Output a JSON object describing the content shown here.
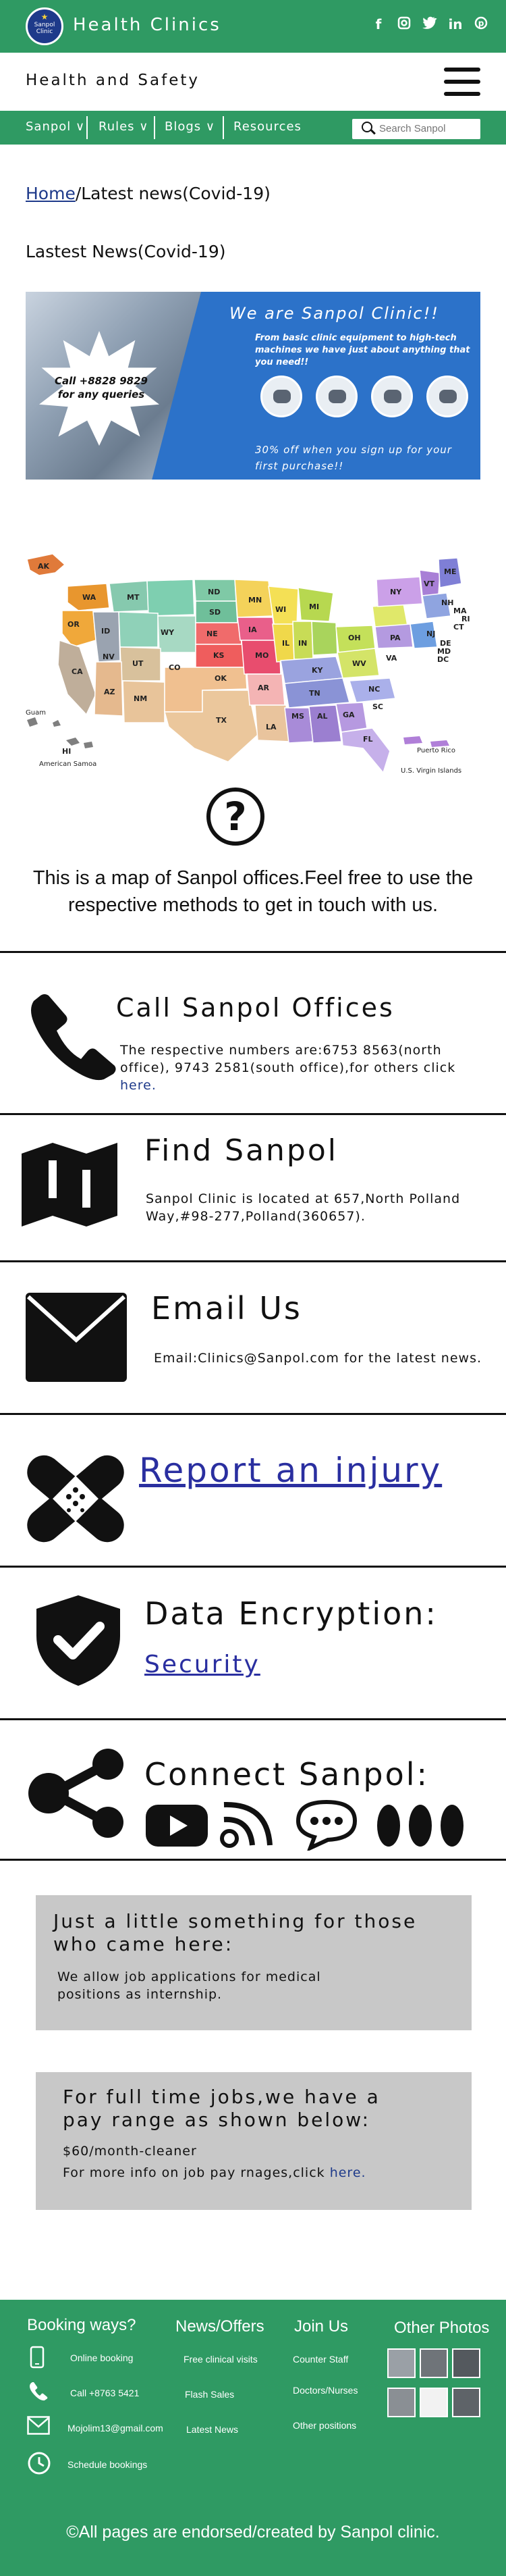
{
  "header": {
    "logo_text": "Sanpol Clinic",
    "brand": "Health Clinics",
    "subtitle": "Health and Safety",
    "social_icons": [
      "facebook-icon",
      "instagram-icon",
      "twitter-icon",
      "linkedin-icon",
      "pinterest-icon"
    ]
  },
  "nav": {
    "items": [
      {
        "label": "Sanpol ∨"
      },
      {
        "label": "Rules ∨"
      },
      {
        "label": "Blogs  ∨"
      },
      {
        "label": "Resources"
      }
    ],
    "search_placeholder": "Search Sanpol"
  },
  "breadcrumb": {
    "home": "Home",
    "current": "/Latest news(Covid-19)"
  },
  "page_heading": "Lastest News(Covid-19)",
  "banner": {
    "call_text": "Call +8828 9829 for any queries",
    "title": "We are Sanpol Clinic!!",
    "subtitle": "From basic clinic equipment to high-tech machines we have just about anything that you need!!",
    "discount": "30% off when you sign up for your first purchase!!"
  },
  "map": {
    "description": "This is a map of Sanpol offices.Feel free to use the respective methods to get in touch with us.",
    "state_labels": [
      "AK",
      "WA",
      "MT",
      "ND",
      "MN",
      "OR",
      "ID",
      "SD",
      "WI",
      "MI",
      "NY",
      "VT",
      "NH",
      "ME",
      "MA",
      "RI",
      "CT",
      "WY",
      "IA",
      "PA",
      "NJ",
      "NV",
      "NE",
      "OH",
      "DE",
      "MD",
      "DC",
      "CA",
      "UT",
      "CO",
      "KS",
      "MO",
      "IL",
      "IN",
      "WV",
      "VA",
      "AZ",
      "NM",
      "OK",
      "AR",
      "KY",
      "TN",
      "NC",
      "TX",
      "LA",
      "MS",
      "AL",
      "GA",
      "SC",
      "FL",
      "HI"
    ],
    "territory_labels": [
      "Guam",
      "American Samoa",
      "Puerto Rico",
      "U.S. Virgin Islands"
    ]
  },
  "sections": {
    "call": {
      "heading": "Call Sanpol Offices",
      "text": "The respective numbers are:6753 8563(north office), 9743 2581(south office),for others click ",
      "link": "here."
    },
    "find": {
      "heading": "Find Sanpol",
      "text": "Sanpol Clinic is located at  657,North Polland Way,#98-277,Polland(360657)."
    },
    "email": {
      "heading": "Email Us",
      "text": "Email:Clinics@Sanpol.com for the latest news."
    },
    "injury": {
      "link": "Report an injury"
    },
    "encryption": {
      "heading": "Data Encryption:",
      "link": "Security"
    },
    "connect": {
      "heading": "Connect Sanpol:"
    }
  },
  "jobs": {
    "heading": "Just a little something for those who came here:",
    "text": "We allow job applications for medical positions as internship."
  },
  "pay": {
    "heading": "For full time jobs,we have a pay range as shown below:",
    "line1": "$60/month-cleaner",
    "line2": "For more info on job pay rnages,click ",
    "link": "here."
  },
  "footer": {
    "booking": {
      "heading": "Booking ways?",
      "items": [
        "Online booking",
        "Call +8763 5421",
        "Mojolim13@gmail.com",
        "Schedule bookings"
      ]
    },
    "news": {
      "heading": "News/Offers",
      "items": [
        "Free clinical visits",
        "Flash Sales",
        "Latest News"
      ]
    },
    "join": {
      "heading": "Join Us",
      "items": [
        "Counter Staff",
        "Doctors/Nurses",
        "Other positions"
      ]
    },
    "photos": {
      "heading": "Other Photos"
    },
    "copyright": "©All pages are endorsed/created by Sanpol clinic."
  },
  "colors": {
    "primary_green": "#2f9a63",
    "banner_blue": "#2c72c9",
    "link_blue": "#2a2fa0",
    "gray_block": "#c8c8c8"
  }
}
